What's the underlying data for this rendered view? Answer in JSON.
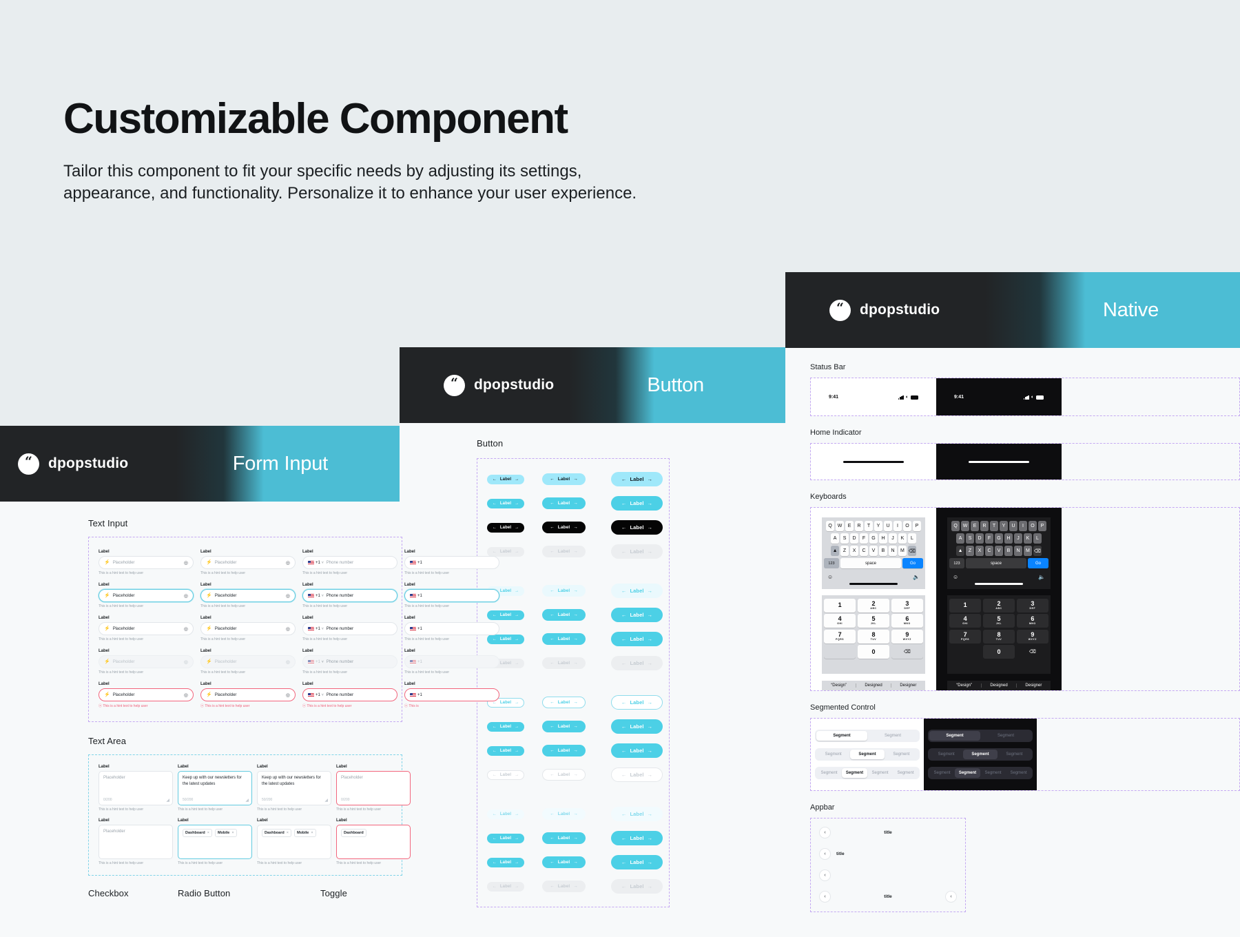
{
  "hero": {
    "title": "Customizable Component",
    "description": "Tailor this component to fit your specific needs by adjusting its settings, appearance, and functionality. Personalize it to enhance your user experience."
  },
  "brand": {
    "name": "dpopstudio",
    "logo_glyph": "“"
  },
  "panels": {
    "form_input": {
      "banner_title": "Form Input",
      "sections": {
        "text_input": "Text Input",
        "text_area": "Text Area",
        "checkbox": "Checkbox",
        "radio_button": "Radio Button",
        "toggle": "Toggle"
      },
      "field": {
        "label": "Label",
        "placeholder": "Placeholder",
        "hint": "This is a hint text to help user",
        "error_hint": "This is a hint text to help user",
        "phone_placeholder": "Phone number",
        "country_code": "+1",
        "lightning_icon": "⚡",
        "eye_icon": "◎",
        "caret_icon": "˅",
        "error_icon": "ⓧ"
      },
      "textarea": {
        "label": "Label",
        "placeholder": "Placeholder",
        "value": "Keep up with our newsletters for the latest updates",
        "counter_empty": "0/200",
        "counter_filled": "50/200",
        "hint": "This is a hint text to help user",
        "chips": [
          "Dashboard",
          "Mobile"
        ],
        "chip_remove_icon": "×",
        "resize_icon": "◢"
      }
    },
    "button": {
      "banner_title": "Button",
      "section_label": "Button",
      "pill": {
        "label": "Label",
        "left_icon": "←",
        "right_icon": "→"
      },
      "sizes": [
        "small",
        "medium",
        "large"
      ],
      "groups": [
        {
          "name": "filled",
          "variants": [
            "lightcyan",
            "cyan",
            "dark",
            "disabled"
          ]
        },
        {
          "name": "ghost",
          "variants": [
            "ghost",
            "cyan",
            "cyan",
            "disabled"
          ]
        },
        {
          "name": "outline",
          "variants": [
            "outline",
            "cyan",
            "cyan",
            "outline-d"
          ]
        },
        {
          "name": "tinted",
          "variants": [
            "tint",
            "cyan",
            "cyan",
            "disabled"
          ]
        }
      ]
    },
    "native": {
      "banner_title": "Native",
      "sections": {
        "status_bar": "Status Bar",
        "home_indicator": "Home Indicator",
        "keyboards": "Keyboards",
        "segmented_control": "Segmented Control",
        "appbar": "Appbar"
      },
      "status_bar": {
        "time": "9:41",
        "signal_icon": "signal-bars-icon",
        "wifi_icon": "◠",
        "battery_icon": "battery-icon"
      },
      "keyboard": {
        "rows": [
          [
            "Q",
            "W",
            "E",
            "R",
            "T",
            "Y",
            "U",
            "I",
            "O",
            "P"
          ],
          [
            "A",
            "S",
            "D",
            "F",
            "G",
            "H",
            "J",
            "K",
            "L"
          ],
          [
            "Z",
            "X",
            "C",
            "V",
            "B",
            "N",
            "M"
          ]
        ],
        "shift_icon": "⬆",
        "backspace_icon": "⌫",
        "numbers_key": "123",
        "space_key": "space",
        "go_key": "Go",
        "emoji_icon": "☺",
        "mic_icon": "Ἲ4"
      },
      "numpad": {
        "keys": [
          {
            "n": "1",
            "s": ""
          },
          {
            "n": "2",
            "s": "ABC"
          },
          {
            "n": "3",
            "s": "DEF"
          },
          {
            "n": "4",
            "s": "GHI"
          },
          {
            "n": "5",
            "s": "JKL"
          },
          {
            "n": "6",
            "s": "MNO"
          },
          {
            "n": "7",
            "s": "PQRS"
          },
          {
            "n": "8",
            "s": "TUV"
          },
          {
            "n": "9",
            "s": "WXYZ"
          },
          {
            "n": "0",
            "s": ""
          }
        ],
        "backspace_icon": "⌫"
      },
      "predictions": [
        "“Design”",
        "Designed",
        "Designer"
      ],
      "segmented": {
        "label": "Segment",
        "rows": [
          {
            "count": 2,
            "active": 0
          },
          {
            "count": 3,
            "active": 1
          },
          {
            "count": 4,
            "active": 1
          }
        ]
      },
      "appbar": {
        "title": "title",
        "back_icon": "‹",
        "action_icon": "‹"
      }
    }
  },
  "colors": {
    "background": "#e8edef",
    "panel": "#f7f9fa",
    "banner_dark": "#222426",
    "banner_accent": "#4cbdd4",
    "cyan": "#4cd0e6",
    "light_cyan": "#9fe8fa",
    "error": "#f2657c",
    "blue": "#0a84ff"
  }
}
